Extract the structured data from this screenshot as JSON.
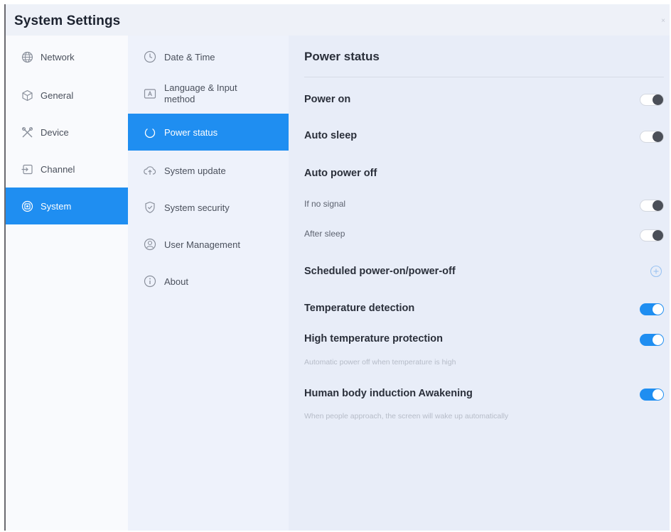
{
  "window": {
    "title": "System Settings",
    "close_symbol": "×"
  },
  "nav1": {
    "items": [
      {
        "label": "Network",
        "icon": "globe-icon",
        "active": false
      },
      {
        "label": "General",
        "icon": "cube-icon",
        "active": false
      },
      {
        "label": "Device",
        "icon": "tools-icon",
        "active": false
      },
      {
        "label": "Channel",
        "icon": "input-source-icon",
        "active": false
      },
      {
        "label": "System",
        "icon": "system-icon",
        "active": true
      }
    ]
  },
  "nav2": {
    "items": [
      {
        "label": "Date & Time",
        "icon": "clock-icon",
        "active": false
      },
      {
        "label": "Language & Input method",
        "line1": "Language & Input",
        "line2": "method",
        "icon": "keyboard-icon",
        "active": false
      },
      {
        "label": "Power status",
        "icon": "power-icon",
        "active": true
      },
      {
        "label": "System update",
        "icon": "cloud-upload-icon",
        "active": false
      },
      {
        "label": "System security",
        "icon": "shield-icon",
        "active": false
      },
      {
        "label": "User Management",
        "icon": "user-icon",
        "active": false
      },
      {
        "label": "About",
        "icon": "info-icon",
        "active": false
      }
    ]
  },
  "main": {
    "section_title": "Power status",
    "power_on": {
      "label": "Power on",
      "enabled": false
    },
    "auto_sleep": {
      "label": "Auto sleep",
      "enabled": false
    },
    "auto_power_off": {
      "label": "Auto power off",
      "if_no_signal": {
        "label": "If no signal",
        "enabled": false
      },
      "after_sleep": {
        "label": "After sleep",
        "enabled": false
      }
    },
    "scheduled": {
      "label": "Scheduled power-on/power-off",
      "action_icon": "add-circle-icon"
    },
    "temperature_detection": {
      "label": "Temperature detection",
      "enabled": true
    },
    "high_temp_protection": {
      "label": "High temperature protection",
      "description": "Automatic power off when temperature is high",
      "enabled": true
    },
    "human_body": {
      "label": "Human body induction Awakening",
      "description": "When people approach, the screen will wake up automatically",
      "enabled": true
    }
  },
  "colors": {
    "accent": "#1f8ef1",
    "toggle_off_knob": "#4b4f58"
  }
}
